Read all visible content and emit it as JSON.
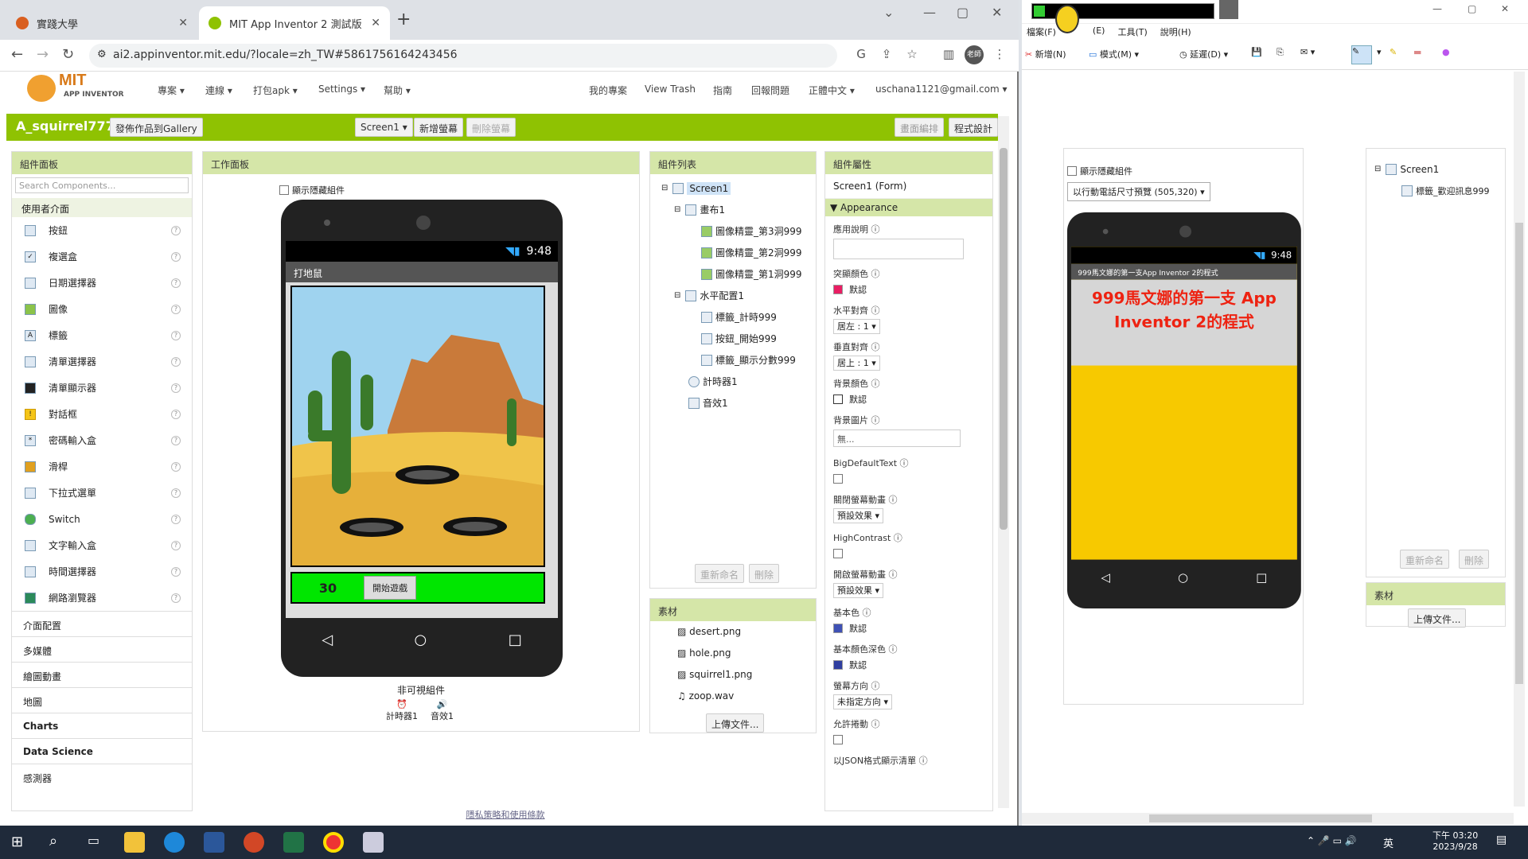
{
  "browser": {
    "tabs": [
      {
        "label": "實踐大學",
        "color": "#d95f20"
      },
      {
        "label": "MIT App Inventor 2 測試版",
        "color": "#8fc202"
      }
    ],
    "url": "ai2.appinventor.mit.edu/?locale=zh_TW#5861756164243456",
    "avatar": "老師"
  },
  "app": {
    "logo_line1": "MIT",
    "logo_line2": "APP INVENTOR",
    "menus": [
      "專案",
      "連線",
      "打包apk",
      "Settings",
      "幫助"
    ],
    "right_menus": [
      "我的專案",
      "View Trash",
      "指南",
      "回報問題",
      "正體中文",
      "uschana1121@gmail.com"
    ],
    "project_name": "A_squirrel777",
    "publish_button": "發佈作品到Gallery",
    "screen_select": "Screen1",
    "add_screen": "新增螢幕",
    "remove_screen": "刪除螢幕",
    "designer": "畫面編排",
    "blocks": "程式設計"
  },
  "palette": {
    "title": "組件面板",
    "search_placeholder": "Search Components...",
    "category": "使用者介面",
    "items": [
      "按鈕",
      "複選盒",
      "日期選擇器",
      "圖像",
      "標籤",
      "清單選擇器",
      "清單顯示器",
      "對話框",
      "密碼輸入盒",
      "滑桿",
      "下拉式選單",
      "Switch",
      "文字輸入盒",
      "時間選擇器",
      "網路瀏覽器"
    ],
    "other_categories": [
      "介面配置",
      "多媒體",
      "繪圖動畫",
      "地圖",
      "Charts",
      "Data Science",
      "感測器"
    ]
  },
  "viewer": {
    "title": "工作面板",
    "show_hidden": "顯示隱藏組件",
    "time": "9:48",
    "app_title": "打地鼠",
    "score": "30",
    "start_button": "開始遊戲",
    "nonvisible_title": "非可視組件",
    "nonvisible": [
      "計時器1",
      "音效1"
    ]
  },
  "tree": {
    "title": "組件列表",
    "items": [
      "Screen1",
      "畫布1",
      "圖像精靈_第3洞999",
      "圖像精靈_第2洞999",
      "圖像精靈_第1洞999",
      "水平配置1",
      "標籤_計時999",
      "按鈕_開始999",
      "標籤_顯示分數999",
      "計時器1",
      "音效1"
    ],
    "rename": "重新命名",
    "delete": "刪除"
  },
  "media": {
    "title": "素材",
    "files": [
      "desert.png",
      "hole.png",
      "squirrel1.png",
      "zoop.wav"
    ],
    "upload": "上傳文件..."
  },
  "props": {
    "title": "組件屬性",
    "subtitle": "Screen1 (Form)",
    "section": "Appearance",
    "about": "應用說明",
    "accent": "突顯顏色",
    "accent_val": "默認",
    "halign": "水平對齊",
    "halign_val": "居左 : 1",
    "valign": "垂直對齊",
    "valign_val": "居上 : 1",
    "bg": "背景顏色",
    "bg_val": "默認",
    "bgimg": "背景圖片",
    "bgimg_val": "無...",
    "bigtext": "BigDefaultText",
    "close_anim": "關閉螢幕動畫",
    "close_anim_val": "預設效果",
    "high_contrast": "HighContrast",
    "open_anim": "開啟螢幕動畫",
    "open_anim_val": "預設效果",
    "primary": "基本色",
    "primary_val": "默認",
    "primary_dark": "基本顏色深色",
    "primary_dark_val": "默認",
    "orientation": "螢幕方向",
    "orientation_val": "未指定方向",
    "scroll": "允許捲動",
    "json": "以JSON格式顯示清單"
  },
  "footer_link": "隱私策略和使用條款",
  "right": {
    "menus": [
      "檔案(F)",
      "(E)",
      "工具(T)",
      "說明(H)"
    ],
    "new_btn": "新增(N)",
    "mode_btn": "模式(M)",
    "delay_btn": "延遲(D)",
    "show_hidden": "顯示隱藏組件",
    "device_select": "以行動電話尺寸預覽 (505,320)",
    "time": "9:48",
    "app_title": "999馬文娜的第一支App Inventor 2的程式",
    "heading": "999馬文娜的第一支 App Inventor 2的程式",
    "tree_items": [
      "Screen1",
      "標籤_歡迎訊息999"
    ],
    "rename": "重新命名",
    "delete": "刪除",
    "media_title": "素材",
    "upload": "上傳文件..."
  },
  "taskbar": {
    "time": "下午 03:20",
    "date": "2023/9/28",
    "ime": "英"
  }
}
